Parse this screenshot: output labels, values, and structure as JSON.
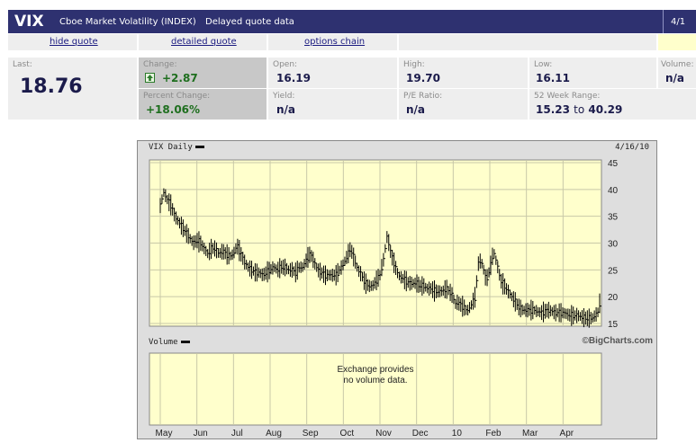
{
  "header": {
    "symbol": "VIX",
    "name": "Cboe Market Volatility (INDEX)",
    "delay_note": "Delayed quote data",
    "date": "4/1"
  },
  "links": {
    "hide_quote": "hide quote",
    "detailed_quote": "detailed quote",
    "options_chain": "options chain"
  },
  "quote": {
    "last_label": "Last:",
    "last_value": "18.76",
    "change_label": "Change:",
    "change_value": "+2.87",
    "pct_label": "Percent Change:",
    "pct_value": "+18.06%",
    "open_label": "Open:",
    "open_value": "16.19",
    "yield_label": "Yield:",
    "yield_value": "n/a",
    "high_label": "High:",
    "high_value": "19.70",
    "pe_label": "P/E Ratio:",
    "pe_value": "n/a",
    "low_label": "Low:",
    "low_value": "16.11",
    "range_label": "52 Week Range:",
    "range_low": "15.23",
    "range_to": "to",
    "range_high": "40.29",
    "volume_label": "Volume:",
    "volume_value": "n/a"
  },
  "chart_panel": {
    "price_title": "VIX Daily",
    "date": "4/16/10",
    "volume_title": "Volume",
    "credit": "©BigCharts.com",
    "volume_message_1": "Exchange provides",
    "volume_message_2": "no volume data."
  },
  "chart_data": {
    "type": "line",
    "title": "VIX Daily",
    "y_ticks": [
      15,
      20,
      25,
      30,
      35,
      40,
      45
    ],
    "ylim": [
      15,
      45
    ],
    "x_ticks": [
      "May",
      "Jun",
      "Jul",
      "Aug",
      "Sep",
      "Oct",
      "Nov",
      "Dec",
      "10",
      "Feb",
      "Mar",
      "Apr"
    ],
    "grid": true,
    "colors": {
      "plot_bg": "#ffffcc",
      "grid": "#c8c8a8",
      "bars": "#000000"
    },
    "series": [
      {
        "values": [
          [
            0,
            37
          ],
          [
            0.1,
            39.5
          ],
          [
            0.2,
            38
          ],
          [
            0.3,
            37
          ],
          [
            0.4,
            35
          ],
          [
            0.5,
            34
          ],
          [
            0.6,
            33
          ],
          [
            0.7,
            32
          ],
          [
            0.8,
            31
          ],
          [
            0.9,
            30
          ],
          [
            1,
            30.5
          ],
          [
            1.1,
            30
          ],
          [
            1.2,
            29
          ],
          [
            1.3,
            28
          ],
          [
            1.4,
            29
          ],
          [
            1.5,
            29
          ],
          [
            1.6,
            28
          ],
          [
            1.7,
            28.5
          ],
          [
            1.8,
            28
          ],
          [
            1.9,
            27.5
          ],
          [
            2,
            28
          ],
          [
            2.1,
            29.5
          ],
          [
            2.2,
            28
          ],
          [
            2.3,
            26.5
          ],
          [
            2.4,
            25.5
          ],
          [
            2.5,
            25
          ],
          [
            2.6,
            24.5
          ],
          [
            2.7,
            24.5
          ],
          [
            2.8,
            24
          ],
          [
            2.9,
            24.5
          ],
          [
            3,
            25
          ],
          [
            3.1,
            25.5
          ],
          [
            3.2,
            25
          ],
          [
            3.3,
            25.5
          ],
          [
            3.4,
            25.5
          ],
          [
            3.5,
            25
          ],
          [
            3.6,
            25
          ],
          [
            3.7,
            24.5
          ],
          [
            3.8,
            25.5
          ],
          [
            3.9,
            25.5
          ],
          [
            4,
            27
          ],
          [
            4.1,
            28
          ],
          [
            4.2,
            26.5
          ],
          [
            4.3,
            25
          ],
          [
            4.4,
            24.5
          ],
          [
            4.5,
            24
          ],
          [
            4.6,
            24
          ],
          [
            4.7,
            24
          ],
          [
            4.8,
            24
          ],
          [
            4.9,
            25
          ],
          [
            5,
            26
          ],
          [
            5.1,
            27.5
          ],
          [
            5.2,
            29
          ],
          [
            5.3,
            27
          ],
          [
            5.4,
            25
          ],
          [
            5.5,
            24
          ],
          [
            5.6,
            22.5
          ],
          [
            5.7,
            22
          ],
          [
            5.8,
            22
          ],
          [
            5.9,
            23
          ],
          [
            6,
            24
          ],
          [
            6.1,
            27
          ],
          [
            6.2,
            31.5
          ],
          [
            6.3,
            28
          ],
          [
            6.4,
            26
          ],
          [
            6.5,
            24
          ],
          [
            6.6,
            23.5
          ],
          [
            6.7,
            23
          ],
          [
            6.8,
            22.5
          ],
          [
            6.9,
            22.5
          ],
          [
            7,
            22.5
          ],
          [
            7.1,
            22
          ],
          [
            7.2,
            22
          ],
          [
            7.3,
            21.5
          ],
          [
            7.4,
            21.5
          ],
          [
            7.5,
            21
          ],
          [
            7.6,
            21
          ],
          [
            7.7,
            21
          ],
          [
            7.8,
            21.5
          ],
          [
            7.9,
            21
          ],
          [
            8,
            20
          ],
          [
            8.05,
            18.5
          ],
          [
            8.1,
            19
          ],
          [
            8.2,
            18.5
          ],
          [
            8.3,
            18
          ],
          [
            8.35,
            17.5
          ],
          [
            8.4,
            17.5
          ],
          [
            8.5,
            18.5
          ],
          [
            8.6,
            20
          ],
          [
            8.7,
            27
          ],
          [
            8.8,
            26
          ],
          [
            8.9,
            23
          ],
          [
            9,
            25
          ],
          [
            9.1,
            28.5
          ],
          [
            9.2,
            26
          ],
          [
            9.3,
            23
          ],
          [
            9.4,
            22
          ],
          [
            9.5,
            21
          ],
          [
            9.6,
            20
          ],
          [
            9.7,
            19
          ],
          [
            9.8,
            18
          ],
          [
            9.9,
            17.5
          ],
          [
            10,
            17.5
          ],
          [
            10.2,
            17.5
          ],
          [
            10.4,
            17
          ],
          [
            10.6,
            17.5
          ],
          [
            10.8,
            17
          ],
          [
            11,
            17
          ],
          [
            11.2,
            16.5
          ],
          [
            11.4,
            16.5
          ],
          [
            11.6,
            16
          ],
          [
            11.8,
            16
          ],
          [
            11.95,
            17
          ],
          [
            12,
            18.76
          ]
        ]
      }
    ]
  }
}
